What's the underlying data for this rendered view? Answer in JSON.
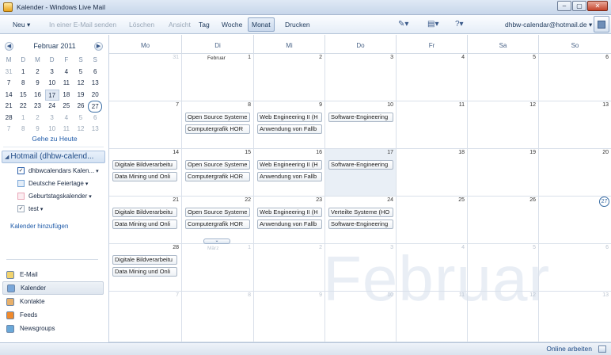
{
  "window": {
    "title": "Kalender - Windows Live Mail",
    "min": "–",
    "max": "▢",
    "close": "✕"
  },
  "toolbar": {
    "neu": "Neu",
    "email_senden": "In einer E-Mail senden",
    "loeschen": "Löschen",
    "ansicht": "Ansicht",
    "tag": "Tag",
    "woche": "Woche",
    "monat": "Monat",
    "drucken": "Drucken",
    "account": "dhbw-calendar@hotmail.de"
  },
  "mini_calendar": {
    "title": "Februar 2011",
    "weekday_headers": [
      "M",
      "D",
      "M",
      "D",
      "F",
      "S",
      "S"
    ],
    "weeks": [
      [
        "31",
        "1",
        "2",
        "3",
        "4",
        "5",
        "6"
      ],
      [
        "7",
        "8",
        "9",
        "10",
        "11",
        "12",
        "13"
      ],
      [
        "14",
        "15",
        "16",
        "17",
        "18",
        "19",
        "20"
      ],
      [
        "21",
        "22",
        "23",
        "24",
        "25",
        "26",
        "27"
      ],
      [
        "28",
        "1",
        "2",
        "3",
        "4",
        "5",
        "6"
      ],
      [
        "7",
        "8",
        "9",
        "10",
        "11",
        "12",
        "13"
      ]
    ],
    "today_link": "Gehe zu Heute"
  },
  "account_section": {
    "title": "Hotmail (dhbw-calend...",
    "calendars": [
      {
        "label": "dhbwcalendars Kalen...",
        "checked": true,
        "dropdown": true,
        "color": "#2b5faa"
      },
      {
        "label": "Deutsche Feiertage",
        "checked": false,
        "dropdown": true,
        "color": "#79a7d9"
      },
      {
        "label": "Geburtstagskalender",
        "checked": false,
        "dropdown": true,
        "color": "#e9a7b8"
      },
      {
        "label": "test",
        "checked": true,
        "dropdown": true,
        "color": "#9aa8b8"
      }
    ],
    "add_calendar": "Kalender hinzufügen"
  },
  "navigation": [
    "E-Mail",
    "Kalender",
    "Kontakte",
    "Feeds",
    "Newsgroups"
  ],
  "calendar": {
    "weekdays": [
      "Mo",
      "Di",
      "Mi",
      "Do",
      "Fr",
      "Sa",
      "So"
    ],
    "month_label": "Februar",
    "next_month_label": "März",
    "watermark": "Februar",
    "rows": [
      {
        "days": [
          "31",
          "1",
          "2",
          "3",
          "4",
          "5",
          "6"
        ]
      },
      {
        "days": [
          "7",
          "8",
          "9",
          "10",
          "11",
          "12",
          "13"
        ]
      },
      {
        "days": [
          "14",
          "15",
          "16",
          "17",
          "18",
          "19",
          "20"
        ]
      },
      {
        "days": [
          "21",
          "22",
          "23",
          "24",
          "25",
          "26",
          "27"
        ]
      },
      {
        "days": [
          "28",
          "1",
          "2",
          "3",
          "4",
          "5",
          "6"
        ]
      },
      {
        "days": [
          "7",
          "8",
          "9",
          "10",
          "11",
          "12",
          "13"
        ]
      }
    ],
    "events": {
      "r1": {
        "di": [
          "Open Source Systeme",
          "Computergrafik HOR"
        ],
        "mi": [
          "Web Engineering II (H",
          "Anwendung von Fallb"
        ],
        "do": [
          "Software-Engineering"
        ]
      },
      "r2": {
        "mo": [
          "Digitale Bildverarbeitu",
          "Data Mining und Onli"
        ],
        "di": [
          "Open Source Systeme",
          "Computergrafik HOR"
        ],
        "mi": [
          "Web Engineering II (H",
          "Anwendung von Fallb"
        ],
        "do": [
          "Software-Engineering"
        ]
      },
      "r3": {
        "mo": [
          "Digitale Bildverarbeitu",
          "Data Mining und Onli"
        ],
        "di": [
          "Open Source Systeme",
          "Computergrafik HOR"
        ],
        "mi": [
          "Web Engineering II (H",
          "Anwendung von Fallb"
        ],
        "do": [
          "Verteilte Systeme (HO",
          "Software-Engineering"
        ]
      },
      "r4": {
        "mo": [
          "Digitale Bildverarbeitu",
          "Data Mining und Onli"
        ]
      }
    },
    "more_indicator": "⌄"
  },
  "status": {
    "text": "Online arbeiten"
  }
}
